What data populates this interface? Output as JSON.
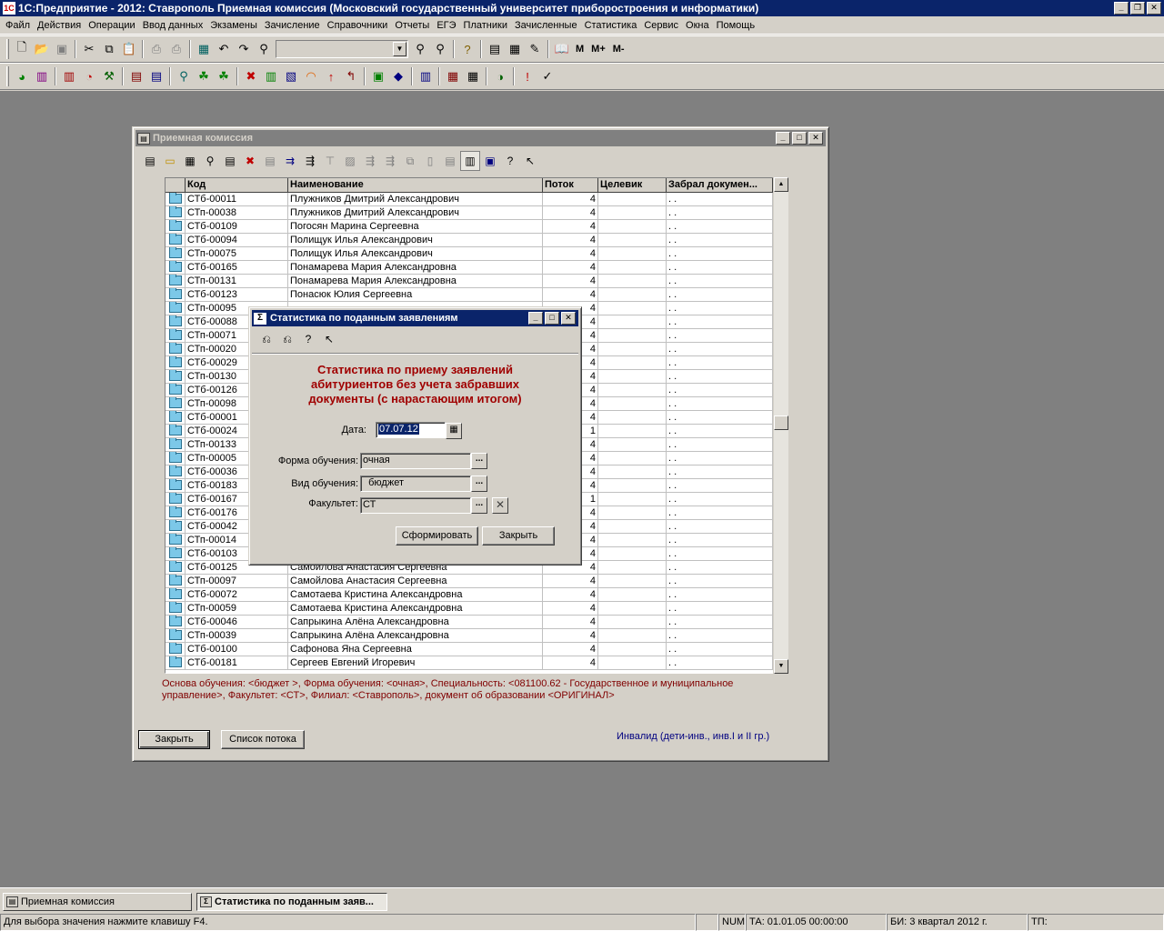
{
  "app": {
    "title": "1С:Предприятие - 2012: Ставрополь Приемная комиссия (Московский государственный университет приборостроения и информатики)",
    "icon_text": "1С"
  },
  "menu": [
    "Файл",
    "Действия",
    "Операции",
    "Ввод данных",
    "Экзамены",
    "Зачисление",
    "Справочники",
    "Отчеты",
    "ЕГЭ",
    "Платники",
    "Зачисленные",
    "Статистика",
    "Сервис",
    "Окна",
    "Помощь"
  ],
  "toolbar": {
    "m": "M",
    "m_plus": "M+",
    "m_minus": "M-"
  },
  "main_window": {
    "title": "Приемная комиссия",
    "columns": [
      "Код",
      "Наименование",
      "Поток",
      "Целевик",
      "Забрал докумен..."
    ],
    "rows": [
      [
        "СТб-00011",
        "Плужников Дмитрий Александрович",
        "4",
        "",
        ". ."
      ],
      [
        "СТп-00038",
        "Плужников Дмитрий Александрович",
        "4",
        "",
        ". ."
      ],
      [
        "СТб-00109",
        "Погосян Марина Сергеевна",
        "4",
        "",
        ". ."
      ],
      [
        "СТб-00094",
        "Полищук Илья Александрович",
        "4",
        "",
        ". ."
      ],
      [
        "СТп-00075",
        "Полищук Илья Александрович",
        "4",
        "",
        ". ."
      ],
      [
        "СТб-00165",
        "Понамарева Мария Александровна",
        "4",
        "",
        ". ."
      ],
      [
        "СТп-00131",
        "Понамарева Мария Александровна",
        "4",
        "",
        ". ."
      ],
      [
        "СТб-00123",
        "Понасюк Юлия Сергеевна",
        "4",
        "",
        ". ."
      ],
      [
        "СТп-00095",
        "",
        "4",
        "",
        ". ."
      ],
      [
        "СТб-00088",
        "",
        "4",
        "",
        ". ."
      ],
      [
        "СТп-00071",
        "",
        "4",
        "",
        ". ."
      ],
      [
        "СТп-00020",
        "",
        "4",
        "",
        ". ."
      ],
      [
        "СТб-00029",
        "",
        "4",
        "",
        ". ."
      ],
      [
        "СТп-00130",
        "",
        "4",
        "",
        ". ."
      ],
      [
        "СТб-00126",
        "",
        "4",
        "",
        ". ."
      ],
      [
        "СТп-00098",
        "",
        "4",
        "",
        ". ."
      ],
      [
        "СТб-00001",
        "",
        "4",
        "",
        ". ."
      ],
      [
        "СТб-00024",
        "",
        "1",
        "",
        ". ."
      ],
      [
        "СТп-00133",
        "",
        "4",
        "",
        ". ."
      ],
      [
        "СТп-00005",
        "",
        "4",
        "",
        ". ."
      ],
      [
        "СТб-00036",
        "",
        "4",
        "",
        ". ."
      ],
      [
        "СТб-00183",
        "",
        "4",
        "",
        ". ."
      ],
      [
        "СТб-00167",
        "",
        "1",
        "",
        ". ."
      ],
      [
        "СТб-00176",
        "",
        "4",
        "",
        ". ."
      ],
      [
        "СТб-00042",
        "",
        "4",
        "",
        ". ."
      ],
      [
        "СТп-00014",
        "",
        "4",
        "",
        ". ."
      ],
      [
        "СТб-00103",
        "",
        "4",
        "",
        ". ."
      ],
      [
        "СТб-00125",
        "Самойлова Анастасия Сергеевна",
        "4",
        "",
        ". ."
      ],
      [
        "СТп-00097",
        "Самойлова Анастасия Сергеевна",
        "4",
        "",
        ". ."
      ],
      [
        "СТб-00072",
        "Самотаева Кристина Александровна",
        "4",
        "",
        ". ."
      ],
      [
        "СТп-00059",
        "Самотаева Кристина Александровна",
        "4",
        "",
        ". ."
      ],
      [
        "СТб-00046",
        "Сапрыкина Алёна Александровна",
        "4",
        "",
        ". ."
      ],
      [
        "СТп-00039",
        "Сапрыкина Алёна Александровна",
        "4",
        "",
        ". ."
      ],
      [
        "СТб-00100",
        "Сафонова Яна Сергеевна",
        "4",
        "",
        ". ."
      ],
      [
        "СТб-00181",
        "Сергеев Евгений Игоревич",
        "4",
        "",
        ". ."
      ]
    ],
    "filter_info_line1": "Основа обучения: <бюджет  >,   Форма обучения: <очная>,   Специальность: <081100.62 - Государственное и муниципальное",
    "filter_info_line2": "управление>,   Факультет: <СТ>,   Филиал: <Ставрополь>,  документ об образовании   <ОРИГИНАЛ>",
    "close_button": "Закрыть",
    "stream_list_button": "Список потока",
    "invalid_note": "Инвалид (дети-инв., инв.I и II гр.)"
  },
  "dialog": {
    "title": "Статистика по поданным заявлениям",
    "heading_line1": "Статистика по приему заявлений",
    "heading_line2": "абитуриентов без учета забравших",
    "heading_line3": "документы (с нарастающим итогом)",
    "date_label": "Дата:",
    "date_value": "07.07.12",
    "form_label": "Форма обучения:",
    "form_value": "очная",
    "kind_label": "Вид обучения:",
    "kind_value": "  бюджет",
    "faculty_label": "Факультет:",
    "faculty_value": "СТ",
    "generate_button": "Сформировать",
    "close_button": "Закрыть"
  },
  "taskbar": {
    "item1": "Приемная комиссия",
    "item2": "Статистика по поданным заяв..."
  },
  "status": {
    "hint": "Для выбора значения нажмите клавишу F4.",
    "num": "NUM",
    "ta": "ТА: 01.01.05  00:00:00",
    "bi": "БИ: 3 квартал 2012 г.",
    "tp": "ТП:"
  }
}
